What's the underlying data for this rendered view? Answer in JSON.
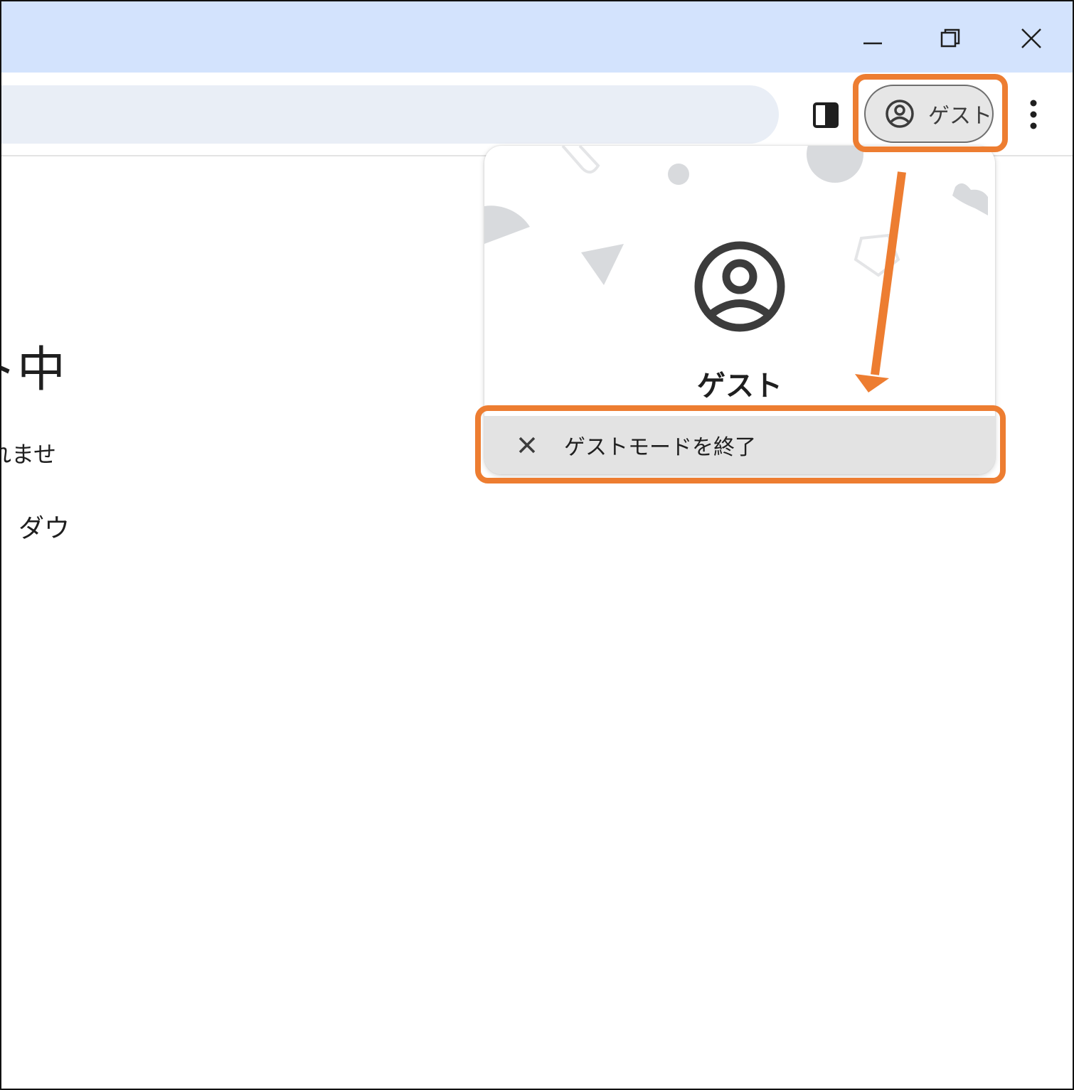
{
  "window_controls": {
    "minimize": "minimize-icon",
    "restore": "restore-icon",
    "close": "close-icon"
  },
  "toolbar": {
    "side_panel_icon": "side-panel-icon",
    "profile_chip_label": "ゲスト",
    "profile_chip_icon": "account-circle-icon",
    "menu_icon": "more-vert-icon"
  },
  "page": {
    "heading_fragment": "ゲスト中",
    "line1_fragment": "れませ",
    "line2_fragment": "ダウ"
  },
  "profile_popup": {
    "avatar_icon": "account-circle-icon",
    "name": "ゲスト",
    "exit_label": "ゲストモードを終了",
    "exit_icon": "close-icon"
  },
  "annotation": {
    "highlight_color": "#ed7d31",
    "arrow": "arrow-down-icon"
  }
}
